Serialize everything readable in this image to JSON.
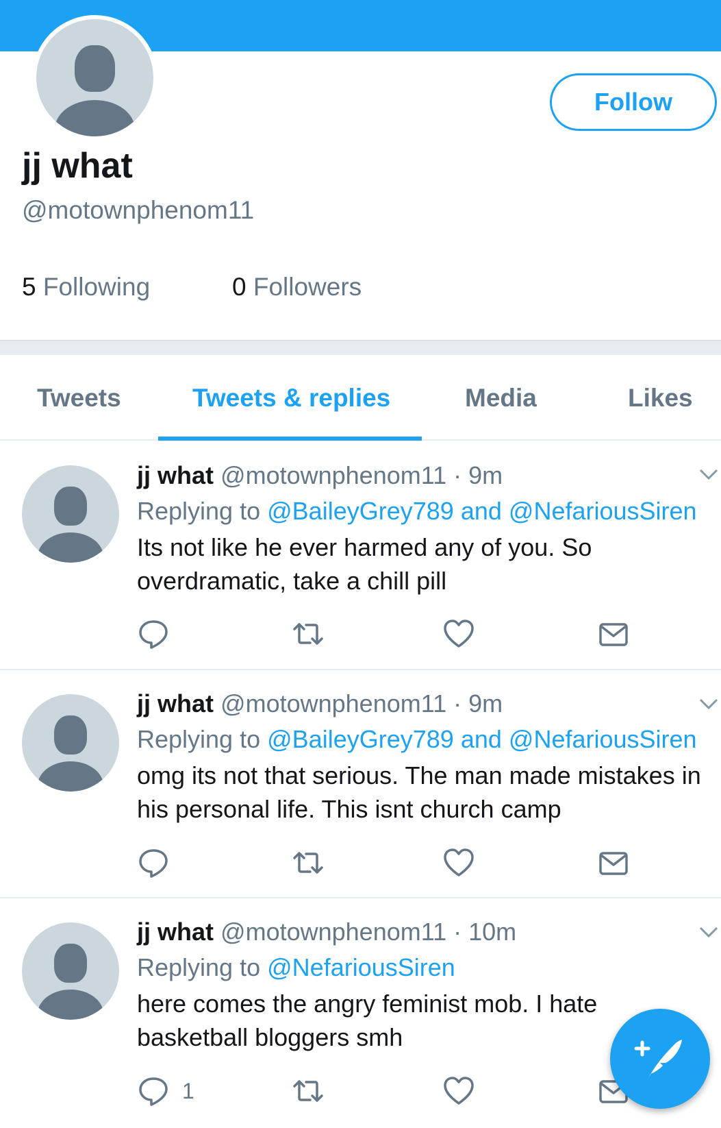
{
  "profile": {
    "display_name": "jj what",
    "handle": "@motownphenom11",
    "follow_label": "Follow",
    "following_count": "5",
    "following_label": "Following",
    "followers_count": "0",
    "followers_label": "Followers"
  },
  "tabs": [
    {
      "label": "Tweets",
      "active": false
    },
    {
      "label": "Tweets & replies",
      "active": true
    },
    {
      "label": "Media",
      "active": false
    },
    {
      "label": "Likes",
      "active": false
    }
  ],
  "tweets": [
    {
      "name": "jj what",
      "handle": "@motownphenom11",
      "time": "9m",
      "replying_prefix": "Replying to",
      "mention1": "@BaileyGrey789",
      "and": "and",
      "mention2": "@NefariousSiren",
      "text": "Its not like he ever harmed any of you. So overdramatic, take a chill pill",
      "reply_count": ""
    },
    {
      "name": "jj what",
      "handle": "@motownphenom11",
      "time": "9m",
      "replying_prefix": "Replying to",
      "mention1": "@BaileyGrey789",
      "and": "and",
      "mention2": "@NefariousSiren",
      "text": "omg its not that serious. The man made mistakes in his personal life. This isnt church camp",
      "reply_count": ""
    },
    {
      "name": "jj what",
      "handle": "@motownphenom11",
      "time": "10m",
      "replying_prefix": "Replying to",
      "mention1": "@NefariousSiren",
      "and": "",
      "mention2": "",
      "text": "here comes the angry feminist mob. I hate basketball bloggers smh",
      "reply_count": "1"
    }
  ],
  "icons": {
    "reply": "reply-icon",
    "retweet": "retweet-icon",
    "like": "heart-icon",
    "dm": "envelope-icon",
    "compose": "compose-tweet-icon",
    "chevron": "chevron-down-icon"
  },
  "colors": {
    "accent": "#1da1f2",
    "secondary_text": "#657786",
    "avatar_bg": "#ccd6dd"
  }
}
